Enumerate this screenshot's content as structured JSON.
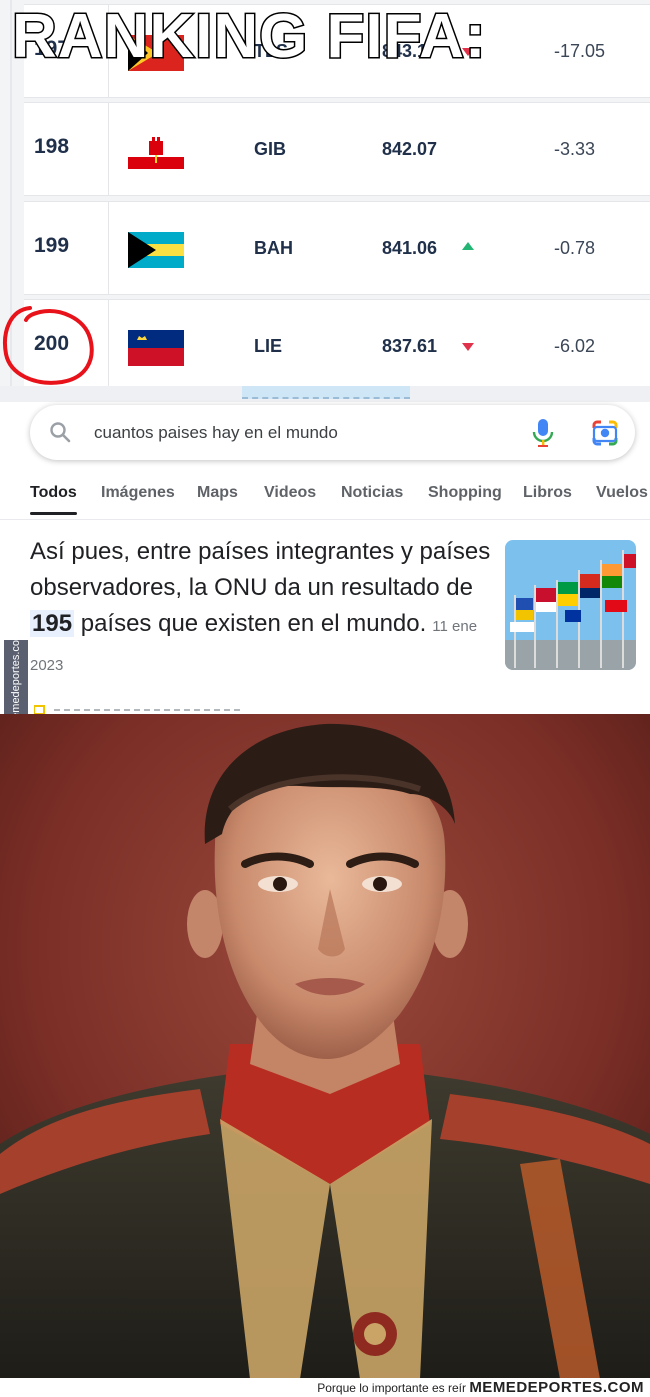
{
  "meme": {
    "title": "RANKING FIFA:",
    "side_watermark": "Memedeportes.com",
    "footer_tagline": "Porque lo importante es reír",
    "footer_brand": "MEMEDEPORTES.COM"
  },
  "ranking": {
    "rows": [
      {
        "position": "197",
        "code": "TLS",
        "points": "843.1",
        "trend": "down",
        "change": "-17.05"
      },
      {
        "position": "198",
        "code": "GIB",
        "points": "842.07",
        "trend": "none",
        "change": "-3.33"
      },
      {
        "position": "199",
        "code": "BAH",
        "points": "841.06",
        "trend": "up",
        "change": "-0.78"
      },
      {
        "position": "200",
        "code": "LIE",
        "points": "837.61",
        "trend": "down",
        "change": "-6.02"
      }
    ],
    "colors": {
      "down": "#e0324a",
      "up": "#22b573",
      "text": "#20304a"
    }
  },
  "google": {
    "query": "cuantos paises hay en el mundo",
    "tabs": [
      "Todos",
      "Imágenes",
      "Maps",
      "Videos",
      "Noticias",
      "Shopping",
      "Libros",
      "Vuelos"
    ],
    "active_tab": "Todos",
    "snippet_before": "Así pues, entre países integrantes y países observadores, la ONU da un resultado de ",
    "snippet_highlight": "195",
    "snippet_after": " países que existen en el mundo.",
    "snippet_date": "11 ene 2023"
  },
  "icons": {
    "search": "search-icon",
    "mic": "microphone-icon",
    "lens": "google-lens-icon"
  }
}
